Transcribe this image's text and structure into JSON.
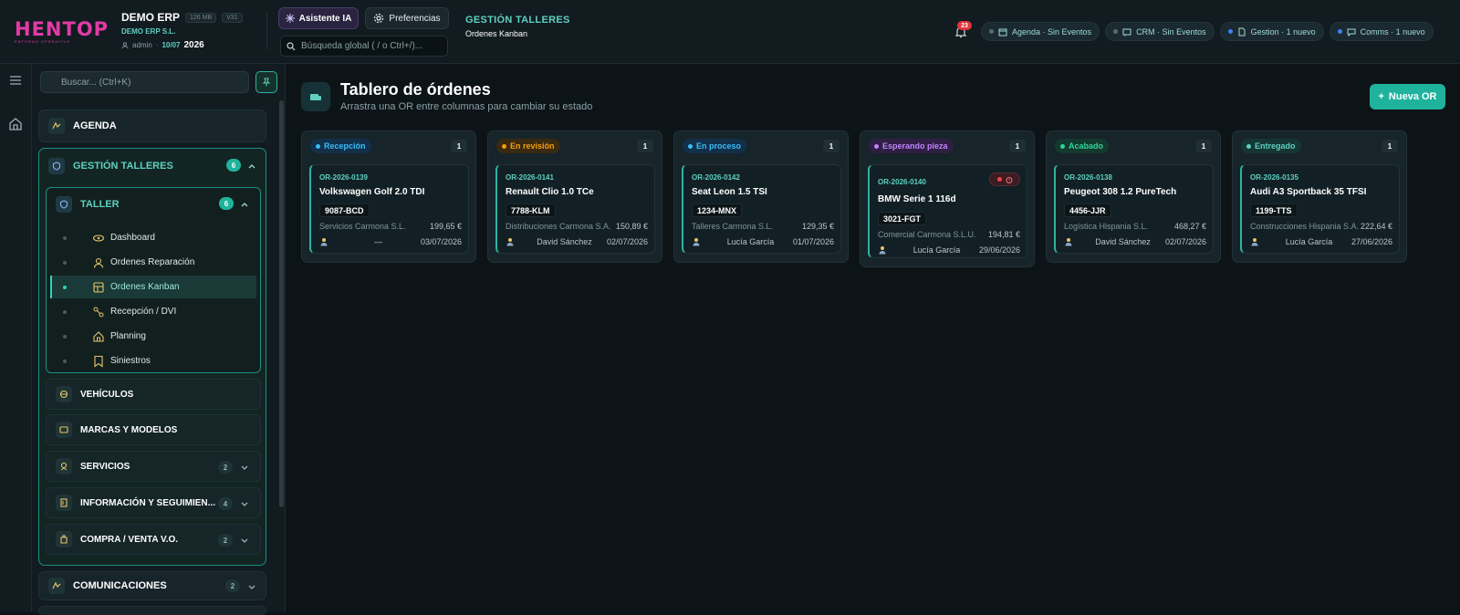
{
  "app": {
    "logo_text": "HENTOP",
    "logo_sub": "ENTORNO OPERATIVO",
    "company_name": "DEMO ERP",
    "memory": "126 MB",
    "version": "V31",
    "company_sub": "DEMO ERP S.L.",
    "user": "admin",
    "date": "10/07",
    "year": "2026"
  },
  "toolbar": {
    "ai_label": "Asistente IA",
    "prefs_label": "Preferencias",
    "search_placeholder": "Búsqueda global ( / o Ctrl+/)..."
  },
  "breadcrumb": {
    "section": "GESTIÓN TALLERES",
    "page": "Ordenes Kanban"
  },
  "notifications": {
    "count": "23"
  },
  "status_pills": [
    {
      "label": "Agenda · Sin Eventos",
      "dot": "#5b6b70",
      "icon": "calendar-icon"
    },
    {
      "label": "CRM · Sin Eventos",
      "dot": "#5b6b70",
      "icon": "crm-icon"
    },
    {
      "label": "Gestion · 1 nuevo",
      "dot": "#3b82f6",
      "icon": "document-icon"
    },
    {
      "label": "Comms · 1 nuevo",
      "dot": "#3b82f6",
      "icon": "chat-icon"
    }
  ],
  "sidebar": {
    "search_placeholder": "Buscar... (Ctrl+K)",
    "agenda": "AGENDA",
    "gestion": {
      "label": "GESTIÓN TALLERES",
      "count": "6"
    },
    "taller": {
      "label": "TALLER",
      "count": "6"
    },
    "taller_items": [
      {
        "label": "Dashboard",
        "icon": "eye-icon"
      },
      {
        "label": "Ordenes Reparación",
        "icon": "mechanic-icon"
      },
      {
        "label": "Ordenes Kanban",
        "icon": "kanban-icon"
      },
      {
        "label": "Recepción / DVI",
        "icon": "reception-icon"
      },
      {
        "label": "Planning",
        "icon": "planning-icon"
      },
      {
        "label": "Siniestros",
        "icon": "claims-icon"
      }
    ],
    "vehiculos": "VEHÍCULOS",
    "marcas": "MARCAS Y MODELOS",
    "servicios": {
      "label": "SERVICIOS",
      "count": "2"
    },
    "informacion": {
      "label": "INFORMACIÓN Y SEGUIMIEN...",
      "count": "4"
    },
    "compra": {
      "label": "COMPRA / VENTA V.O.",
      "count": "2"
    },
    "comunicaciones": {
      "label": "COMUNICACIONES",
      "count": "2"
    }
  },
  "page": {
    "title": "Tablero de órdenes",
    "subtitle": "Arrastra una OR entre columnas para cambiar su estado",
    "new_button": "Nueva OR"
  },
  "columns": [
    {
      "label": "Recepción",
      "count": "1",
      "color": "#38bdf8",
      "bg": "#12304a",
      "card": {
        "code": "OR-2026-0139",
        "model": "Volkswagen Golf 2.0 TDI",
        "plate": "9087-BCD",
        "client": "Servicios Carmona S.L.",
        "amount": "199,65 €",
        "tech": "—",
        "date": "03/07/2026"
      }
    },
    {
      "label": "En revisión",
      "count": "1",
      "color": "#f59e0b",
      "bg": "#3a2a12",
      "card": {
        "code": "OR-2026-0141",
        "model": "Renault Clio 1.0 TCe",
        "plate": "7788-KLM",
        "client": "Distribuciones Carmona S.A.",
        "amount": "150,89 €",
        "tech": "David Sánchez",
        "date": "02/07/2026"
      }
    },
    {
      "label": "En proceso",
      "count": "1",
      "color": "#38bdf8",
      "bg": "#12304a",
      "card": {
        "code": "OR-2026-0142",
        "model": "Seat Leon 1.5 TSI",
        "plate": "1234-MNX",
        "client": "Talleres Carmona S.L.",
        "amount": "129,35 €",
        "tech": "Lucía García",
        "date": "01/07/2026"
      }
    },
    {
      "label": "Esperando pieza",
      "count": "1",
      "color": "#c084fc",
      "bg": "#2f1f45",
      "card": {
        "code": "OR-2026-0140",
        "model": "BMW Serie 1 116d",
        "plate": "3021-FGT",
        "client": "Comercial Carmona S.L.U.",
        "amount": "194,81 €",
        "tech": "Lucía García",
        "date": "29/06/2026"
      }
    },
    {
      "label": "Acabado",
      "count": "1",
      "color": "#34d399",
      "bg": "#133a2e",
      "card": {
        "code": "OR-2026-0138",
        "model": "Peugeot 308 1.2 PureTech",
        "plate": "4456-JJR",
        "client": "Logística Hispania S.L.",
        "amount": "468,27 €",
        "tech": "David Sánchez",
        "date": "02/07/2026"
      }
    },
    {
      "label": "Entregado",
      "count": "1",
      "color": "#5fd0c0",
      "bg": "#163634",
      "card": {
        "code": "OR-2026-0135",
        "model": "Audi A3 Sportback 35 TFSI",
        "plate": "1199-TTS",
        "client": "Construcciones Hispania S.A.",
        "amount": "222,64 €",
        "tech": "Lucía García",
        "date": "27/06/2026"
      }
    }
  ]
}
